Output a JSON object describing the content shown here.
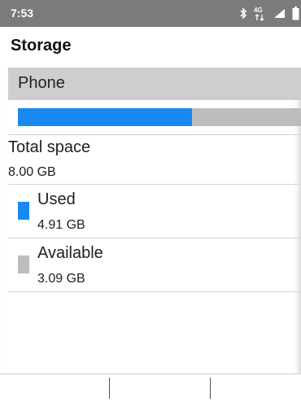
{
  "status_bar": {
    "time": "7:53",
    "network_label": "4G",
    "icons": [
      "bluetooth-icon",
      "network-4g-icon",
      "signal-icon",
      "battery-icon"
    ],
    "color": "#7b7b7b"
  },
  "header": {
    "title": "Storage"
  },
  "storage": {
    "device_label": "Phone",
    "used_fraction": 0.614,
    "colors": {
      "used": "#1889f0",
      "available": "#bdbdbd"
    },
    "total": {
      "label": "Total space",
      "value": "8.00 GB"
    },
    "used": {
      "label": "Used",
      "value": "4.91 GB"
    },
    "available": {
      "label": "Available",
      "value": "3.09 GB"
    }
  },
  "softkeys": {
    "left": "",
    "center": "",
    "right": ""
  }
}
